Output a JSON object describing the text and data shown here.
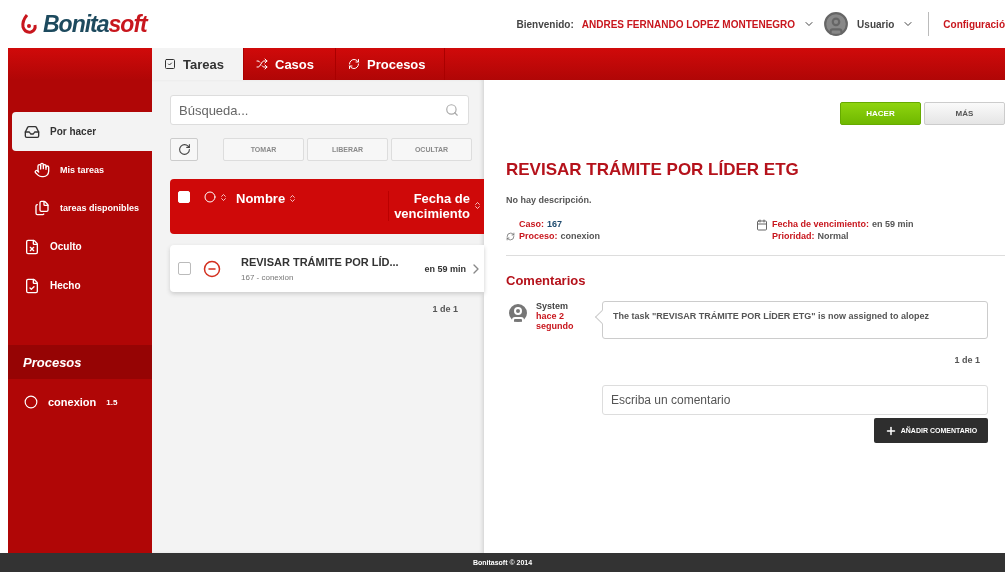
{
  "header": {
    "logo": {
      "part1": "Bonita",
      "part2": "soft"
    },
    "welcome_label": "Bienvenido:",
    "user_name": "ANDRES FERNANDO LOPEZ MONTENEGRO",
    "user_menu": "Usuario",
    "settings_link": "Configuració"
  },
  "tabs": [
    {
      "label": "Tareas",
      "selected": true
    },
    {
      "label": "Casos",
      "selected": false
    },
    {
      "label": "Procesos",
      "selected": false
    }
  ],
  "sidebar": {
    "items": [
      {
        "label": "Por hacer",
        "selected": true,
        "children": [
          {
            "label": "Mis tareas",
            "selected": false
          },
          {
            "label": "tareas disponibles",
            "selected": false
          }
        ]
      },
      {
        "label": "Oculto",
        "selected": false
      },
      {
        "label": "Hecho",
        "selected": false
      }
    ],
    "processes_title": "Procesos",
    "processes": [
      {
        "name": "conexion",
        "version": "1.5"
      }
    ]
  },
  "task_list": {
    "search": {
      "placeholder": "Búsqueda..."
    },
    "actions": [
      {
        "label": "TOMAR",
        "disabled": true
      },
      {
        "label": "LIBERAR",
        "disabled": true
      },
      {
        "label": "OCULTAR",
        "disabled": true
      }
    ],
    "select_all_checked": false,
    "columns": [
      "Nombre",
      "Fecha de vencimiento"
    ],
    "rows": [
      {
        "title": "REVISAR TRÁMITE POR LÍD...",
        "subtitle": "167 - conexion",
        "due": "en 59 min",
        "checked": false,
        "selected": true
      }
    ],
    "pager": "1 de 1"
  },
  "detail": {
    "buttons": [
      {
        "label": "HACER",
        "kind": "primary"
      },
      {
        "label": "MÁS",
        "kind": "secondary"
      }
    ],
    "title": "REVISAR TRÁMITE POR LÍDER ETG",
    "description": "No hay descripción.",
    "fields_left": [
      {
        "label": "Caso:",
        "value": "167",
        "kind": "link"
      },
      {
        "label": "Proceso:",
        "value": "conexion",
        "kind": "plain"
      }
    ],
    "fields_right": [
      {
        "label": "Fecha de vencimiento:",
        "value": "en 59 min"
      },
      {
        "label": "Prioridad:",
        "value": "Normal"
      }
    ],
    "comments_title": "Comentarios",
    "comments": [
      {
        "author": "System",
        "time": "hace 2 segundo",
        "text": "The task \"REVISAR TRÁMITE POR LÍDER ETG\" is now assigned to alopez"
      }
    ],
    "comments_pager": "1 de 1",
    "comment_input": {
      "placeholder": "Escriba un comentario"
    },
    "add_button": "AÑADIR COMENTARIO"
  },
  "footer": "Bonitasoft © 2014"
}
